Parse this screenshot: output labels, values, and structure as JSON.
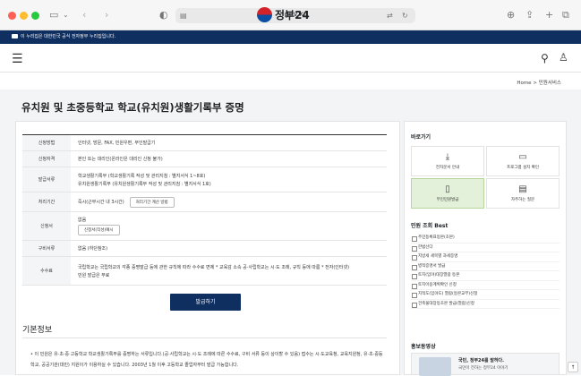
{
  "browser": {
    "url": "gov.kr"
  },
  "gov_banner": {
    "text": "이 누리집은 대한민국 공식 전자정부 누리집입니다."
  },
  "header": {
    "logo_text": "정부24"
  },
  "breadcrumb": {
    "home": "Home",
    "sep": ">",
    "current": "민원서비스"
  },
  "page": {
    "title": "유치원 및 초중등학교 학교(유치원)생활기록부 증명"
  },
  "info": {
    "method": {
      "label": "신청방법",
      "value": "인터넷, 방문, FAX, 민원우편, 무인발급기"
    },
    "qualification": {
      "label": "신청자격",
      "value": "본인 또는 대리인(온라인은 대리인 신청 불가)"
    },
    "documents": {
      "label": "발급서류",
      "line1": "학교생활기록부 (학교생활기록 작성 및 관리지침 : 별지서식 1~8호)",
      "line2": "유치원생활기록부 (유치원생활기록부 작성 및 관리지침 : 별지서식 1호)"
    },
    "period": {
      "label": "처리기간",
      "value": "즉시(근무시간 내 3시간)",
      "btn": "처리기간 계산 방법"
    },
    "form": {
      "label": "신청서",
      "value": "없음",
      "btn": "신청서(작성)예시"
    },
    "required": {
      "label": "구비서류",
      "value": "없음 (하단참조)"
    },
    "fee": {
      "label": "수수료",
      "line1": "국립학교는 국립학교의 각종 증명발급 등에 관한 규칙에 따라 수수료 면제 * 교육감 소속 공·사립학교는 시·도 조례, 규칙 등에 따름 * 전자(인터넷)",
      "line2": "민원 발급은 무료"
    }
  },
  "apply_btn": "발급하기",
  "basic_info": {
    "title": "기본정보",
    "text": "이 민원은 유·초·중·고등학교 학교생활기록부를 증명하는 서류입니다.(공·사립학교는 시·도 조례에 따른 수수료, 구비 서류 등이 상이할 수 있음) 접수는 시·도교육청, 교육지원청, 유·초·중등학교, 공공기관(대민) 지원이가 이용하실 수 있습니다. 2003년 1월 이후 고등학교 졸업자부터 발급 가능합니다."
  },
  "sidebar": {
    "quick_title": "바로가기",
    "quick": [
      {
        "label": "전자문서 안내",
        "icon": "download-icon"
      },
      {
        "label": "프로그램 설치 확인",
        "icon": "monitor-icon"
      },
      {
        "label": "무인민원발급",
        "icon": "kiosk-icon"
      },
      {
        "label": "자주하는 질문",
        "icon": "chat-icon"
      }
    ],
    "best_title": "민원 조회 Best",
    "best": [
      "주민등록표등본(초본)",
      "한법선다",
      "지방세 세목별 과세증명",
      "병적증명서 발급",
      "토지(임야)대장열람 등본",
      "토지이용계획확인 신청",
      "지적도(임야도) 열람(등본교부)신청",
      "건축물대장등초본 발급(열람)신청"
    ],
    "promo_title": "홍보동영상",
    "promo_t1": "국민, 정부24를 말하다.",
    "promo_t2": "국민이 전하는 정부24 이야기"
  }
}
